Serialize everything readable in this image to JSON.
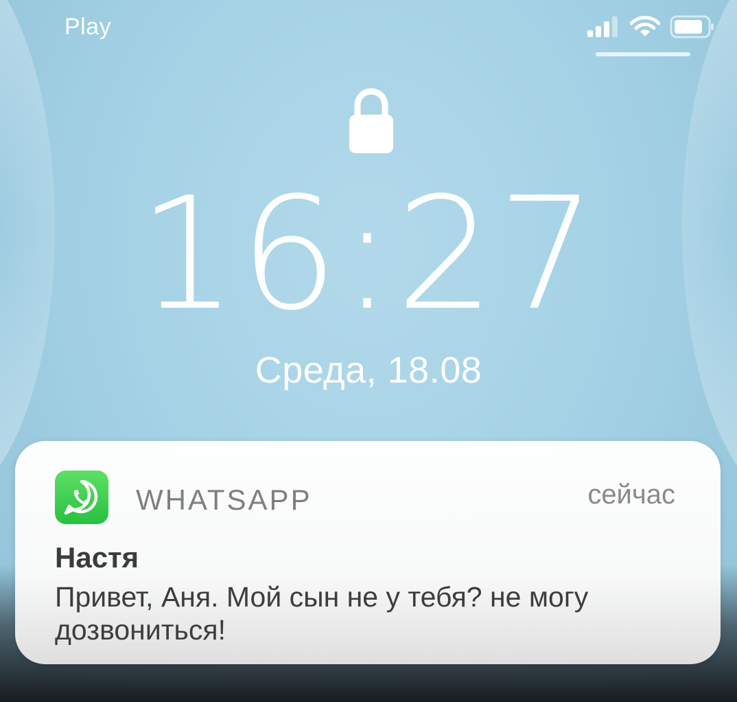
{
  "status_bar": {
    "carrier": "Play",
    "icons": [
      "signal-icon",
      "wifi-icon",
      "battery-icon"
    ]
  },
  "lock_screen": {
    "lock_icon": "lock-icon",
    "time": "16:27",
    "date": "Среда, 18.08"
  },
  "notification": {
    "app_icon": "whatsapp-icon",
    "app_name": "WHATSAPP",
    "time_ago": "сейчас",
    "sender": "Настя",
    "message": "Привет, Аня. Мой сын не у тебя? не могу дозвониться!"
  },
  "colors": {
    "wallpaper": "#a6d2e6",
    "notification_bg": "#ffffff",
    "whatsapp_green": "#28c040"
  }
}
